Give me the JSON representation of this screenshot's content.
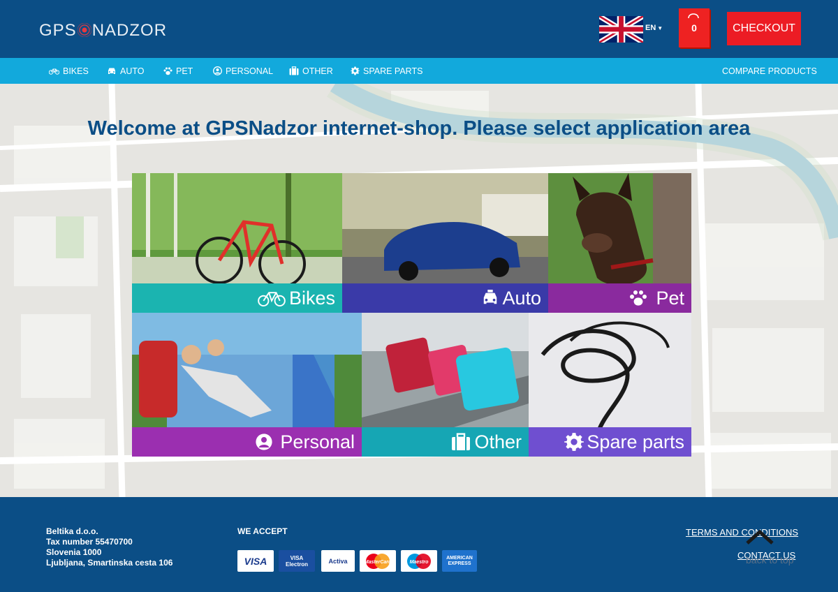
{
  "header": {
    "logo": {
      "left": "GPS",
      "right": "NADZOR"
    },
    "language": "EN",
    "cart_count": "0",
    "checkout_label": "CHECKOUT"
  },
  "nav": {
    "items": [
      {
        "label": "BIKES",
        "icon": "bicycle-icon"
      },
      {
        "label": "AUTO",
        "icon": "car-icon"
      },
      {
        "label": "PET",
        "icon": "paw-icon"
      },
      {
        "label": "PERSONAL",
        "icon": "user-circle-icon"
      },
      {
        "label": "OTHER",
        "icon": "suitcase-icon"
      },
      {
        "label": "SPARE PARTS",
        "icon": "gear-icon"
      }
    ],
    "compare_label": "COMPARE PRODUCTS"
  },
  "main": {
    "title": "Welcome at GPSNadzor internet-shop. Please select application area",
    "tiles": [
      {
        "label": "Bikes",
        "icon": "bicycle-icon",
        "band_color": "#1bb4b0"
      },
      {
        "label": "Auto",
        "icon": "taxi-icon",
        "band_color": "#3a3aa8"
      },
      {
        "label": "Pet",
        "icon": "paw-icon",
        "band_color": "#8a2a9e"
      },
      {
        "label": "Personal",
        "icon": "user-circle-icon",
        "band_color": "#9b2fb0"
      },
      {
        "label": "Other",
        "icon": "suitcase-icon",
        "band_color": "#16a6b4"
      },
      {
        "label": "Spare parts",
        "icon": "gear-icon",
        "band_color": "#6f4fd0"
      }
    ]
  },
  "footer": {
    "company": [
      "Beltika d.o.o.",
      "Tax number 55470700",
      "Slovenia 1000",
      "Ljubljana, Smartinska cesta 106"
    ],
    "we_accept": "WE ACCEPT",
    "cards": [
      "VISA",
      "VISA Electron",
      "Activa",
      "MasterCard",
      "Maestro",
      "AMERICAN EXPRESS"
    ],
    "terms": "TERMS AND CONDITIONS",
    "contact": "CONTACT US",
    "back_to_top": "back to top"
  },
  "colors": {
    "header": "#0b4e86",
    "nav": "#12a9dc",
    "checkout": "#ec1c24",
    "title": "#0b4e86"
  }
}
